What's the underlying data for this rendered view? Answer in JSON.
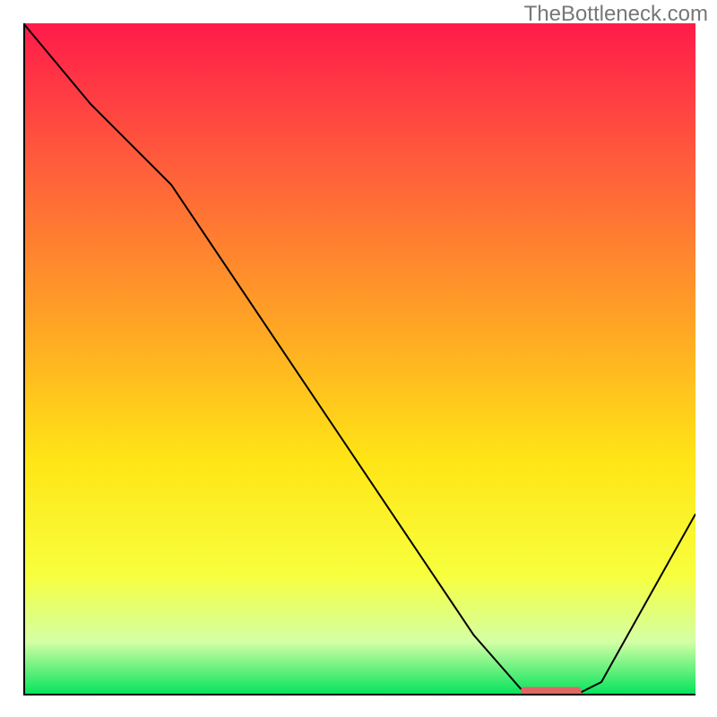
{
  "watermark": "TheBottleneck.com",
  "chart_data": {
    "type": "line",
    "title": "",
    "xlabel": "",
    "ylabel": "",
    "xlim": [
      0,
      100
    ],
    "ylim": [
      0,
      100
    ],
    "series": [
      {
        "name": "curve",
        "x": [
          0,
          10,
          22,
          67,
          74,
          82,
          86,
          100
        ],
        "y": [
          100,
          88,
          76,
          9,
          1,
          0,
          2,
          27
        ]
      }
    ],
    "highlight_segment": {
      "x0": 74,
      "x1": 83,
      "y": 0.6
    },
    "gradient_stops": [
      {
        "offset": 0.0,
        "color": "#ff1b4a"
      },
      {
        "offset": 0.2,
        "color": "#ff5a3c"
      },
      {
        "offset": 0.45,
        "color": "#ffa524"
      },
      {
        "offset": 0.65,
        "color": "#ffe516"
      },
      {
        "offset": 0.82,
        "color": "#f7ff3d"
      },
      {
        "offset": 0.92,
        "color": "#d4ffa5"
      },
      {
        "offset": 1.0,
        "color": "#00e35a"
      }
    ],
    "colors": {
      "axis": "#000000",
      "curve": "#000000",
      "highlight": "#e06666"
    }
  }
}
